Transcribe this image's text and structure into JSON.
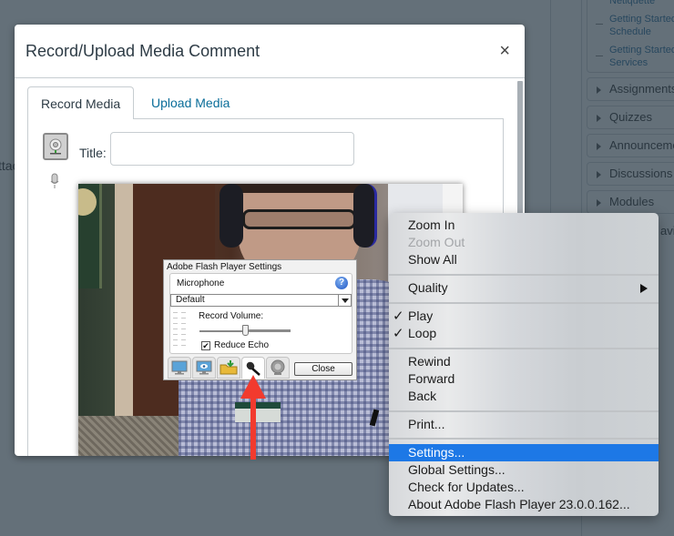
{
  "background": {
    "left_partial_text": "ttac",
    "nav_sub_items": [
      "Netiquette",
      "Getting Started Schedule",
      "Getting Started Services"
    ],
    "nav_sections": [
      "Assignments",
      "Quizzes",
      "Announcements",
      "Discussions",
      "Modules"
    ],
    "nav_partial_text": "avi"
  },
  "modal": {
    "title": "Record/Upload Media Comment",
    "close_label": "×",
    "tabs": [
      {
        "label": "Record Media",
        "active": true
      },
      {
        "label": "Upload Media",
        "active": false
      }
    ],
    "title_field": {
      "label": "Title:",
      "value": "",
      "placeholder": ""
    }
  },
  "flash_settings": {
    "window_title": "Adobe Flash Player Settings",
    "section": "Microphone",
    "help_label": "?",
    "device": "Default",
    "volume_label": "Record Volume:",
    "record_volume_fraction": 0.5,
    "reduce_echo": {
      "label": "Reduce Echo",
      "checked": true,
      "mark": "✔"
    },
    "tabs": [
      {
        "icon": "privacy-monitor-icon",
        "active": false
      },
      {
        "icon": "display-settings-icon",
        "active": false
      },
      {
        "icon": "local-storage-folder-icon",
        "active": false
      },
      {
        "icon": "microphone-icon",
        "active": true
      },
      {
        "icon": "camera-icon",
        "active": false
      }
    ],
    "close_label": "Close"
  },
  "annotation": {
    "arrow_color": "#f23a2e",
    "points_to": "microphone tab"
  },
  "context_menu": {
    "groups": [
      [
        {
          "label": "Zoom In",
          "enabled": true
        },
        {
          "label": "Zoom Out",
          "enabled": false
        },
        {
          "label": "Show All",
          "enabled": true
        }
      ],
      [
        {
          "label": "Quality",
          "enabled": true,
          "submenu": true
        }
      ],
      [
        {
          "label": "Play",
          "enabled": true,
          "checked": true
        },
        {
          "label": "Loop",
          "enabled": true,
          "checked": true
        }
      ],
      [
        {
          "label": "Rewind",
          "enabled": true
        },
        {
          "label": "Forward",
          "enabled": true
        },
        {
          "label": "Back",
          "enabled": true
        }
      ],
      [
        {
          "label": "Print...",
          "enabled": true
        }
      ],
      [
        {
          "label": "Settings...",
          "enabled": true,
          "highlighted": true
        },
        {
          "label": "Global Settings...",
          "enabled": true
        },
        {
          "label": "Check for Updates...",
          "enabled": true
        },
        {
          "label": "About Adobe Flash Player 23.0.0.162...",
          "enabled": true
        }
      ]
    ],
    "check_mark": "✓",
    "highlight_color": "#1d78e6"
  }
}
